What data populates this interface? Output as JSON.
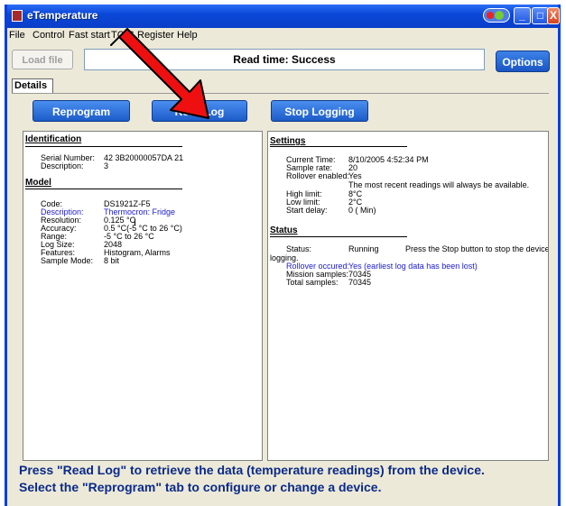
{
  "window": {
    "title": "eTemperature"
  },
  "titlebar_buttons": {
    "minimize": "_",
    "maximize": "□",
    "close": "X"
  },
  "menu": [
    "File",
    "Control",
    "Fast start",
    "TC-S",
    "Register",
    "Help"
  ],
  "toolbar": {
    "load_file": "Load file",
    "status": "Read time: Success",
    "options": "Options"
  },
  "tabs": [
    "Details"
  ],
  "actions": {
    "reprogram": "Reprogram",
    "read_log": "Read Log",
    "stop_logging": "Stop Logging"
  },
  "identification": {
    "heading": "Identification",
    "rows": [
      {
        "label": "Serial Number:",
        "value": "42 3B20000057DA 21"
      },
      {
        "label": "Description:",
        "value": "3"
      }
    ]
  },
  "model": {
    "heading": "Model",
    "rows": [
      {
        "label": "Code:",
        "value": "DS1921Z-F5"
      },
      {
        "label": "Description:",
        "value": "Thermocron: Fridge"
      },
      {
        "label": "Resolution:",
        "value": "0.125 °C"
      },
      {
        "label": "Accuracy:",
        "value": "0.5 °C(-5 °C to 26 °C)"
      },
      {
        "label": "Range:",
        "value": "-5 °C to 26 °C"
      },
      {
        "label": "Log Size:",
        "value": "2048"
      },
      {
        "label": "Features:",
        "value": "Histogram, Alarms"
      },
      {
        "label": "Sample Mode:",
        "value": "8 bit"
      }
    ]
  },
  "settings": {
    "heading": "Settings",
    "rows": [
      {
        "label": "Current Time:",
        "value": "8/10/2005 4:52:34 PM"
      },
      {
        "label": "Sample rate:",
        "value": "20"
      },
      {
        "label": "Rollover enabled:",
        "value": "Yes"
      },
      {
        "label": "",
        "value": "The most recent readings will always be available."
      },
      {
        "label": "High limit:",
        "value": "8°C"
      },
      {
        "label": "Low limit:",
        "value": "2°C"
      },
      {
        "label": "Start delay:",
        "value": "0 ( Min)"
      }
    ]
  },
  "status": {
    "heading": "Status",
    "status_label": "Status:",
    "status_value": "Running",
    "status_note": "Press the Stop button to stop the device",
    "status_note_cont": "logging.",
    "rows": [
      {
        "label": "Rollover occured:",
        "value": "Yes (earliest log data has been lost)"
      },
      {
        "label": "Mission samples:",
        "value": "70345"
      },
      {
        "label": "Total samples:",
        "value": "70345"
      }
    ]
  },
  "instructions": [
    "Press \"Read Log\" to retrieve the data (temperature readings) from the device.",
    "Select the \"Reprogram\" tab to configure or change a device."
  ]
}
